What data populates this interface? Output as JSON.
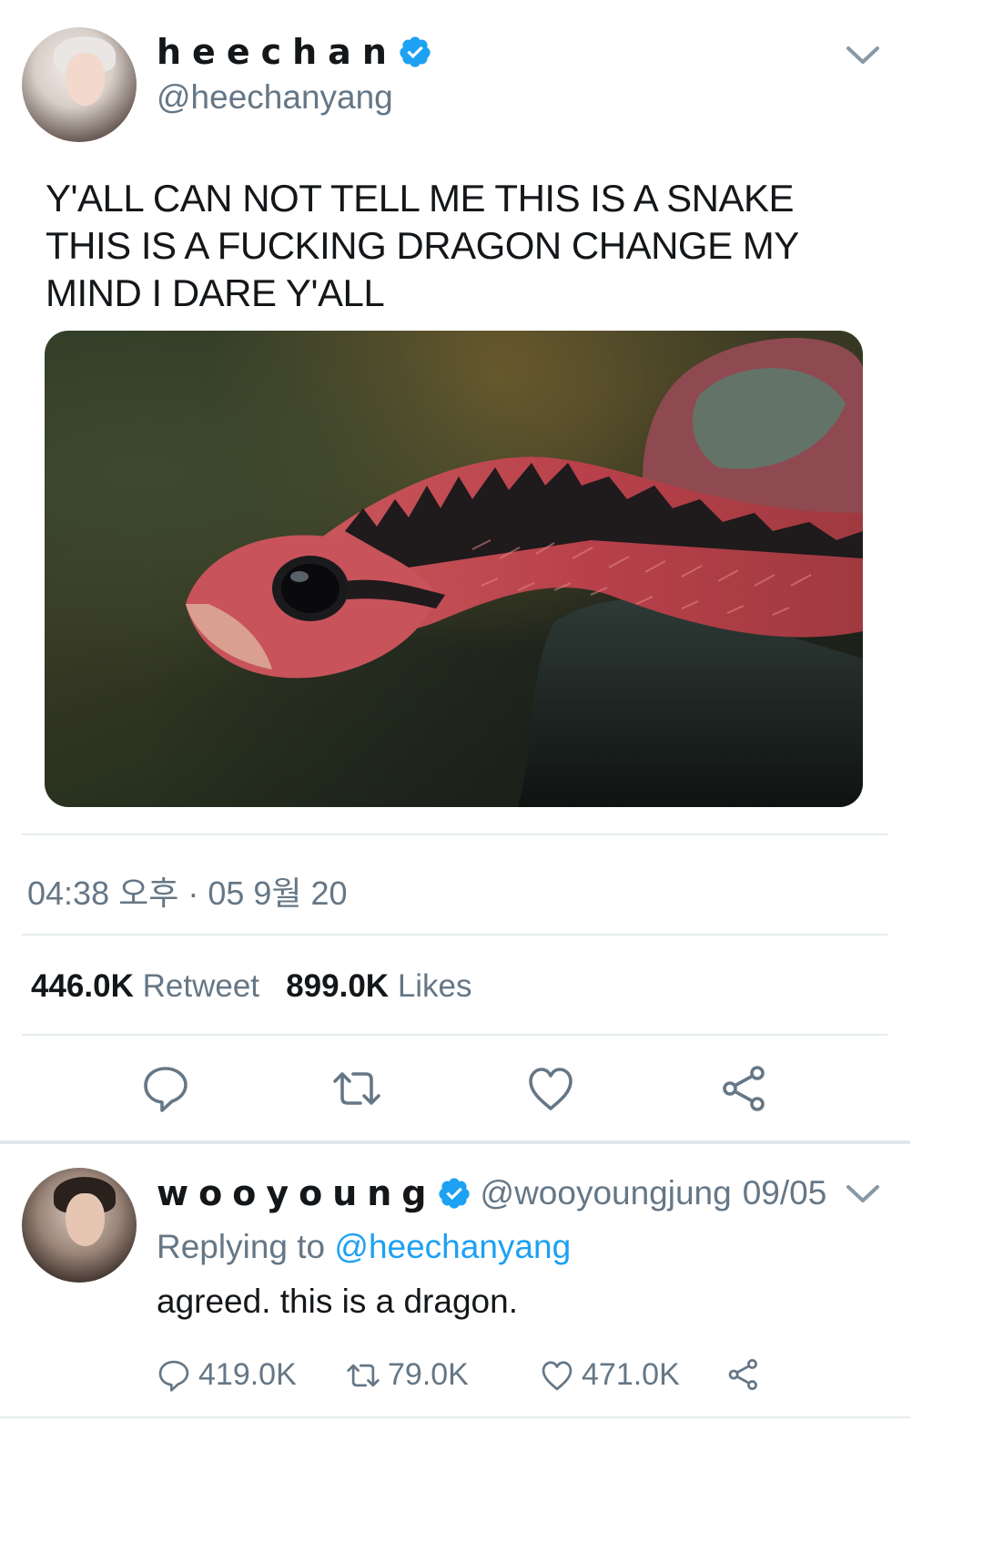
{
  "tweet": {
    "author_name": "heechan",
    "author_handle": "@heechanyang",
    "text": "Y'ALL CAN NOT TELL ME THIS IS A SNAKE THIS IS A FUCKING DRAGON CHANGE MY MIND I DARE Y'ALL",
    "timestamp": "04:38 오후 · 05 9월 20",
    "retweet_count": "446.0K",
    "retweet_label": "Retweet",
    "like_count": "899.0K",
    "like_label": "Likes",
    "icons": [
      "verified-icon",
      "chevron-down-icon",
      "reply-icon",
      "retweet-icon",
      "like-icon",
      "share-icon"
    ]
  },
  "reply": {
    "author_name": "wooyoung",
    "author_handle": "@wooyoungjung",
    "date": "09/05",
    "replying_prefix": "Replying to",
    "replying_to": "@heechanyang",
    "text": "agreed. this is a dragon.",
    "reply_count": "419.0K",
    "retweet_count": "79.0K",
    "like_count": "471.0K"
  },
  "colors": {
    "accent": "#1da1f2",
    "secondary_text": "#657786",
    "primary_text": "#14171a",
    "divider": "#e6ecf0"
  }
}
